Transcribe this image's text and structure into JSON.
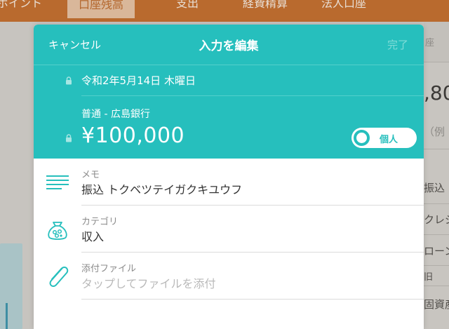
{
  "background": {
    "tabs": [
      {
        "label": "ポイント"
      },
      {
        "label": "口座残高"
      },
      {
        "label": "支出"
      },
      {
        "label": "経費精算"
      },
      {
        "label": "法人口座"
      }
    ],
    "right_column": {
      "header": "座",
      "amount_fragment": ",80",
      "example_fragment": "（例",
      "list": [
        "振込",
        "クレジ",
        "ローン",
        "旧",
        "固資産"
      ]
    }
  },
  "sheet": {
    "cancel_label": "キャンセル",
    "title": "入力を編集",
    "done_label": "完了",
    "date": "令和2年5月14日 木曜日",
    "account": "普通 - 広島銀行",
    "amount": "¥100,000",
    "toggle_label": "個人",
    "rows": [
      {
        "label": "メモ",
        "value": "振込 トクベツテイガクキユウフ",
        "icon": "memo-lines-icon"
      },
      {
        "label": "カテゴリ",
        "value": "収入",
        "icon": "money-bag-icon"
      },
      {
        "label": "添付ファイル",
        "value": "タップしてファイルを添付",
        "icon": "paperclip-icon"
      }
    ]
  },
  "colors": {
    "accent": "#26bfbd",
    "done_disabled": "#82dcd8",
    "background_nav": "#b96a2e"
  }
}
